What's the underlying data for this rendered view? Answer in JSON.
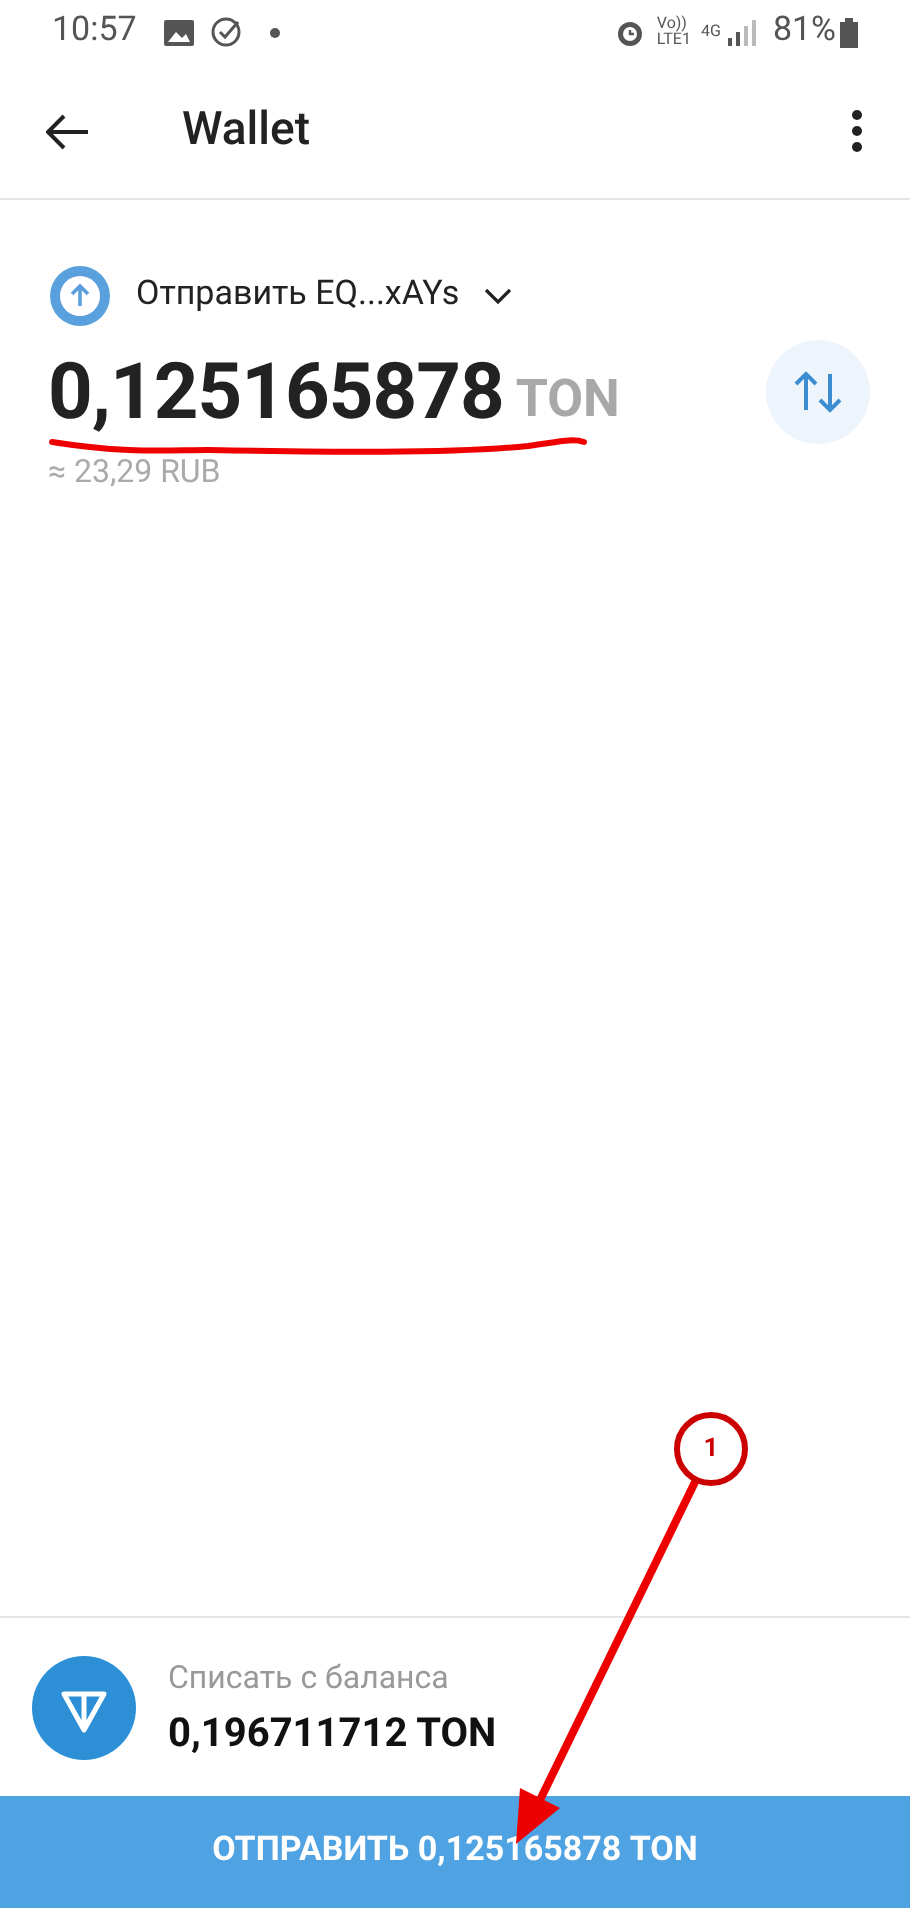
{
  "status_bar": {
    "time": "10:57",
    "network_top": "Vo))",
    "network_bottom": "LTE1",
    "data_type": "4G",
    "battery": "81%"
  },
  "app_bar": {
    "title": "Wallet"
  },
  "send": {
    "label": "Отправить EQ...xAYs",
    "amount": "0,125165878",
    "currency": "TON",
    "fiat": "≈ 23,29 RUB"
  },
  "source": {
    "label": "Списать с баланса",
    "balance": "0,196711712 TON"
  },
  "submit": {
    "label": "ОТПРАВИТЬ 0,125165878 TON"
  },
  "annotation": {
    "number": "1"
  }
}
